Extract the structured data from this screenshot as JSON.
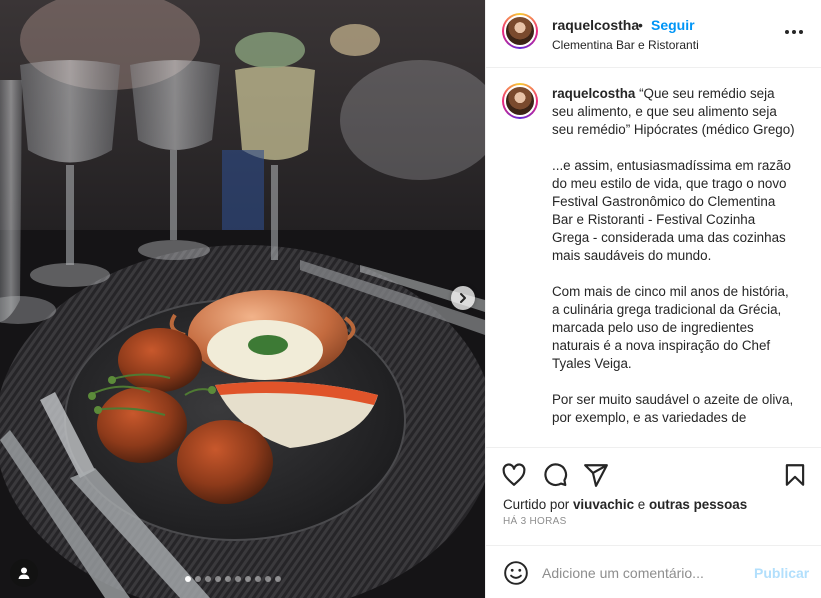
{
  "post": {
    "username": "raquelcostha",
    "separator": "•",
    "follow_label": "Seguir",
    "location": "Clementina Bar e Ristoranti",
    "more_icon": "more-horizontal-icon"
  },
  "caption": {
    "username": "raquelcostha",
    "paragraphs": [
      "“Que seu remédio seja seu alimento, e que seu alimento seja seu remédio” Hipócrates (médico Grego)",
      "...e assim, entusiasmadíssima em razão do meu estilo de vida, que trago o novo Festival Gastronômico do Clementina Bar e Ristoranti - Festival Cozinha Grega - considerada uma das cozinhas mais saudáveis do mundo.",
      "Com mais de cinco mil anos de história, a culinária grega tradicional da Grécia, marcada pelo uso de ingredientes naturais é a nova inspiração do Chef Tyales Veiga.",
      "Por ser muito saudável o azeite de oliva, por exemplo, e as variedades de"
    ]
  },
  "actions": {
    "icons": [
      "heart-icon",
      "comment-icon",
      "share-icon",
      "bookmark-icon"
    ],
    "liked_by_prefix": "Curtido por",
    "liked_by_user": "viuvachic",
    "liked_by_connector": "e",
    "liked_by_others": "outras pessoas",
    "timestamp": "HÁ 3 HORAS"
  },
  "comment": {
    "placeholder": "Adicione um comentário...",
    "publish_label": "Publicar",
    "emoji_icon": "emoji-icon"
  },
  "media": {
    "carousel_total": 10,
    "carousel_active": 1,
    "next_icon": "chevron-right-icon",
    "tag_icon": "user-tag-icon"
  },
  "colors": {
    "accent": "#0095f6",
    "publish_disabled": "#b2dffc",
    "text": "#262626",
    "muted": "#8e8e8e",
    "border": "#efefef"
  }
}
